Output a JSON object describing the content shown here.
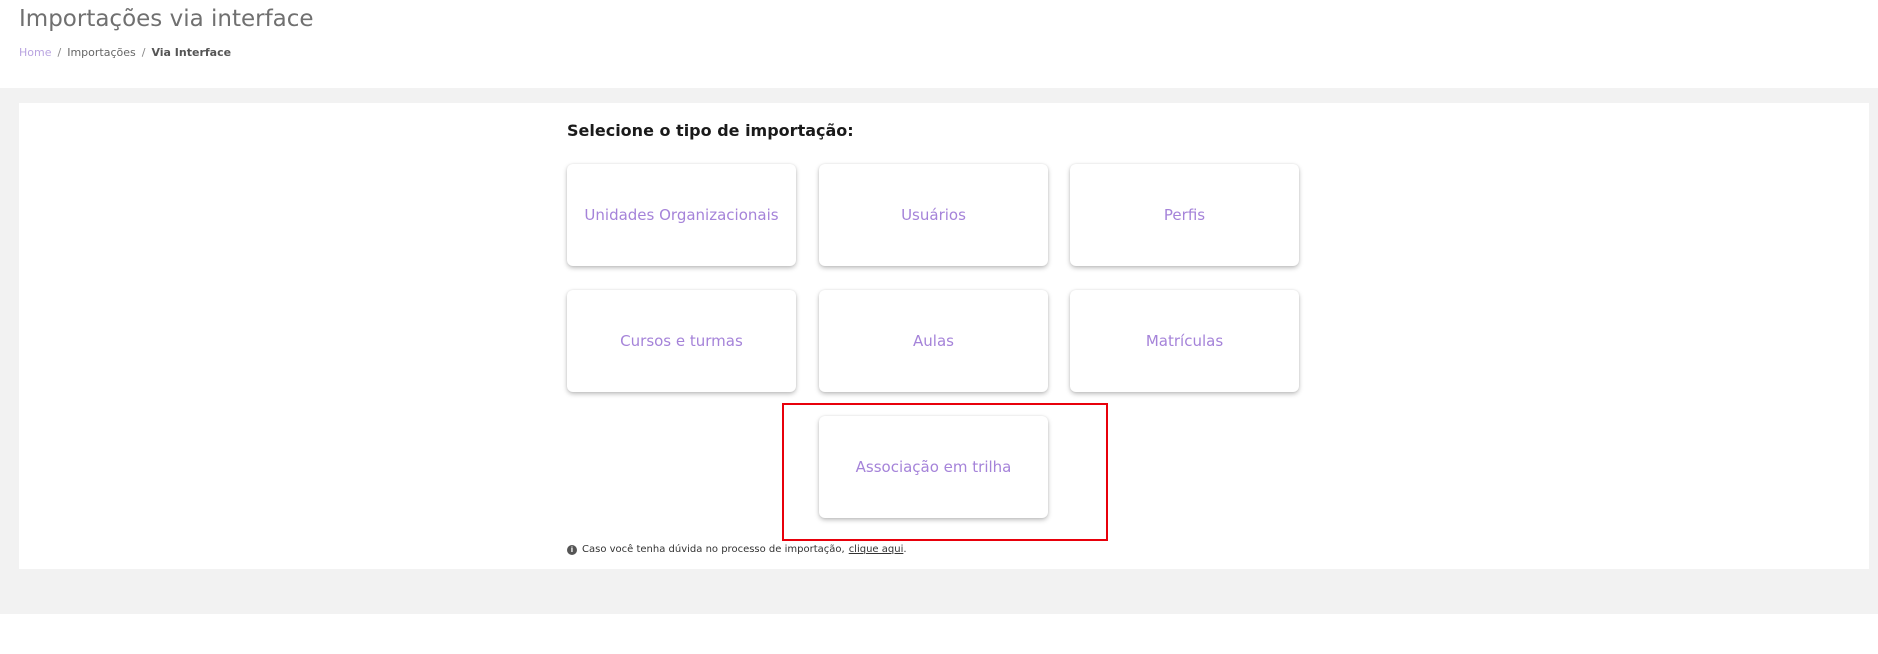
{
  "header": {
    "title": "Importações via interface",
    "breadcrumb": {
      "home": "Home",
      "separator": "/",
      "middle": "Importações",
      "current": "Via Interface"
    }
  },
  "main": {
    "section_title": "Selecione o tipo de importação:",
    "cards": [
      {
        "label": "Unidades Organizacionais"
      },
      {
        "label": "Usuários"
      },
      {
        "label": "Perfis"
      },
      {
        "label": "Cursos e turmas"
      },
      {
        "label": "Aulas"
      },
      {
        "label": "Matrículas"
      },
      {
        "label": "Associação em trilha"
      }
    ],
    "help": {
      "icon": "info-icon",
      "text": "Caso você tenha dúvida no processo de importação,",
      "link_label": "clique aqui",
      "suffix": "."
    }
  },
  "colors": {
    "accent": "#a583d9",
    "breadcrumb_home": "#b9a4e0",
    "highlight": "#e8000b",
    "background_gray": "#f2f2f2"
  }
}
